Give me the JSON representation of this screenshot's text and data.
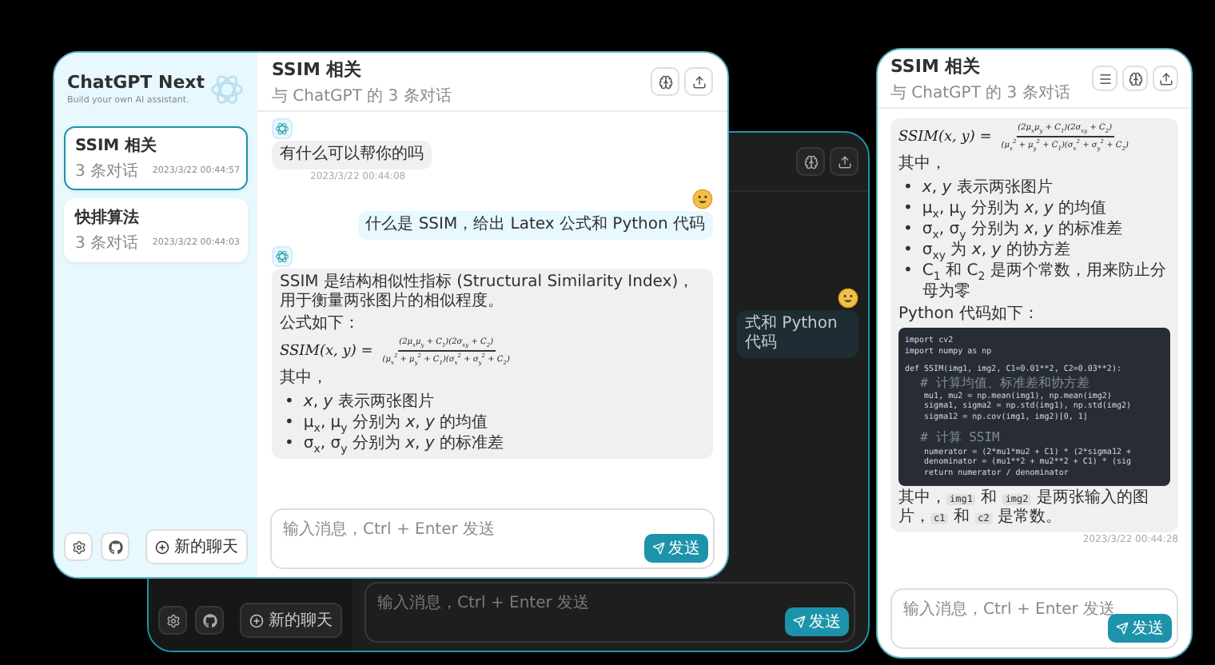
{
  "windows": [
    {
      "kind": "desktop_light",
      "sidebar": {
        "title": "ChatGPT Next",
        "subtitle": "Build your own AI assistant.",
        "chats": [
          {
            "title": "SSIM 相关",
            "count": "3 条对话",
            "time": "2023/3/22 00:44:57",
            "selected": true
          },
          {
            "title": "快排算法",
            "count": "3 条对话",
            "time": "2023/3/22 00:44:03",
            "selected": false
          }
        ],
        "new_chat_button": "新的聊天"
      },
      "chat": {
        "title": "SSIM 相关",
        "subtitle": "与 ChatGPT 的 3 条对话",
        "messages": [
          {
            "kind": "bot",
            "avatar": true,
            "blocks": [
              {
                "kind": "paragraph",
                "text": "有什么可以帮你的吗"
              }
            ],
            "time": "2023/3/22 00:44:08"
          },
          {
            "kind": "user",
            "avatar": true,
            "blocks": [
              {
                "kind": "paragraph",
                "text": "什么是 SSIM，给出 Latex 公式和 Python 代码"
              }
            ]
          },
          {
            "kind": "bot",
            "avatar": true,
            "blocks": [
              {
                "kind": "paragraph",
                "text": "SSIM 是结构相似性指标 (Structural Similarity Index)，用于衡量两张图片的相似程度。"
              },
              {
                "kind": "paragraph",
                "text": "公式如下："
              },
              {
                "kind": "formula",
                "lhs": "SSIM(x, y) =",
                "numerator": "(2μ$_{x}$μ$_{y}$ + C$_{1}$)(2σ$_{xy}$ + C$_{2}$)",
                "denominator": "(μ$_{x}$$^{2}$ + μ$_{y}$$^{2}$ + C$_{1}$)(σ$_{x}$$^{2}$ + σ$_{y}$$^{2}$ + C$_{2}$)"
              },
              {
                "kind": "paragraph",
                "text": "其中，"
              },
              {
                "kind": "list",
                "items": [
                  {
                    "marker": "•",
                    "text": "*x*, *y* 表示两张图片"
                  },
                  {
                    "marker": "•",
                    "text": "μ$_{x}$, μ$_{y}$ 分别为 *x*, *y* 的均值"
                  },
                  {
                    "marker": "•",
                    "text": "σ$_{x}$, σ$_{y}$ 分别为 *x*, *y* 的标准差"
                  }
                ]
              }
            ]
          }
        ],
        "input": {
          "placeholder": "输入消息，Ctrl + Enter 发送"
        },
        "send_button": "发送"
      }
    },
    {
      "kind": "desktop_dark",
      "sidebar": {
        "new_chat_button": "新的聊天"
      },
      "chat": {
        "messages": [
          {
            "kind": "user",
            "avatar": true,
            "blocks": [
              {
                "kind": "paragraph",
                "text": "式和 Python 代码"
              }
            ]
          }
        ],
        "input": {
          "placeholder": "输入消息，Ctrl + Enter 发送"
        },
        "send_button": "发送"
      }
    },
    {
      "kind": "mobile",
      "chat": {
        "title": "SSIM 相关",
        "subtitle": "与 ChatGPT 的 3 条对话",
        "messages": [
          {
            "kind": "bot",
            "avatar": false,
            "blocks": [
              {
                "kind": "formula",
                "lhs": "SSIM(x, y) =",
                "numerator": "(2μ$_{x}$μ$_{y}$ + C$_{1}$)(2σ$_{xy}$ + C$_{2}$)",
                "denominator": "(μ$_{x}$$^{2}$ + μ$_{y}$$^{2}$ + C$_{1}$)(σ$_{x}$$^{2}$ + σ$_{y}$$^{2}$ + C$_{2}$)"
              },
              {
                "kind": "paragraph",
                "text": "其中，"
              },
              {
                "kind": "list",
                "items": [
                  {
                    "marker": "•",
                    "text": "*x*, *y* 表示两张图片"
                  },
                  {
                    "marker": "•",
                    "text": "μ$_{x}$, μ$_{y}$ 分别为 *x*, *y* 的均值"
                  },
                  {
                    "marker": "•",
                    "text": "σ$_{x}$, σ$_{y}$ 分别为 *x*, *y* 的标准差"
                  },
                  {
                    "marker": "•",
                    "text": "σ$_{xy}$ 为 *x*, *y* 的协方差"
                  },
                  {
                    "marker": "•",
                    "text": "C$_{1}$ 和 C$_{2}$ 是两个常数，用来防止分母为零"
                  }
                ]
              },
              {
                "kind": "paragraph",
                "text": "Python 代码如下："
              },
              {
                "kind": "code",
                "lines": [
                  {
                    "kind": "code",
                    "text": "import cv2"
                  },
                  {
                    "kind": "code",
                    "text": "import numpy as np"
                  },
                  {
                    "kind": "blank"
                  },
                  {
                    "kind": "code",
                    "text": "def SSIM(img1, img2, C1=0.01**2, C2=0.03**2):"
                  },
                  {
                    "kind": "comment",
                    "text": "  # 计算均值、标准差和协方差"
                  },
                  {
                    "kind": "code",
                    "text": "    mu1, mu2 = np.mean(img1), np.mean(img2)"
                  },
                  {
                    "kind": "code",
                    "text": "    sigma1, sigma2 = np.std(img1), np.std(img2)"
                  },
                  {
                    "kind": "code",
                    "text": "    sigma12 = np.cov(img1, img2)[0, 1]"
                  },
                  {
                    "kind": "blank"
                  },
                  {
                    "kind": "comment",
                    "text": "  # 计算 SSIM"
                  },
                  {
                    "kind": "code",
                    "text": "    numerator = (2*mu1*mu2 + C1) * (2*sigma12 +"
                  },
                  {
                    "kind": "code",
                    "text": "    denominator = (mu1**2 + mu2**2 + C1) * (sig"
                  },
                  {
                    "kind": "code",
                    "text": "    return numerator / denominator"
                  }
                ]
              },
              {
                "kind": "rich_paragraph",
                "parts": [
                  {
                    "kind": "text",
                    "text": "其中，"
                  },
                  {
                    "kind": "code",
                    "text": "img1"
                  },
                  {
                    "kind": "text",
                    "text": " 和 "
                  },
                  {
                    "kind": "code",
                    "text": "img2"
                  },
                  {
                    "kind": "text",
                    "text": " 是两张输入的图片，"
                  },
                  {
                    "kind": "code",
                    "text": "c1"
                  },
                  {
                    "kind": "text",
                    "text": " 和 "
                  },
                  {
                    "kind": "code",
                    "text": "c2"
                  },
                  {
                    "kind": "text",
                    "text": " 是常数。"
                  }
                ]
              }
            ],
            "time": "2023/3/22 00:44:28"
          }
        ],
        "input": {
          "placeholder": "输入消息，Ctrl + Enter 发送"
        },
        "send_button": "发送"
      }
    }
  ]
}
